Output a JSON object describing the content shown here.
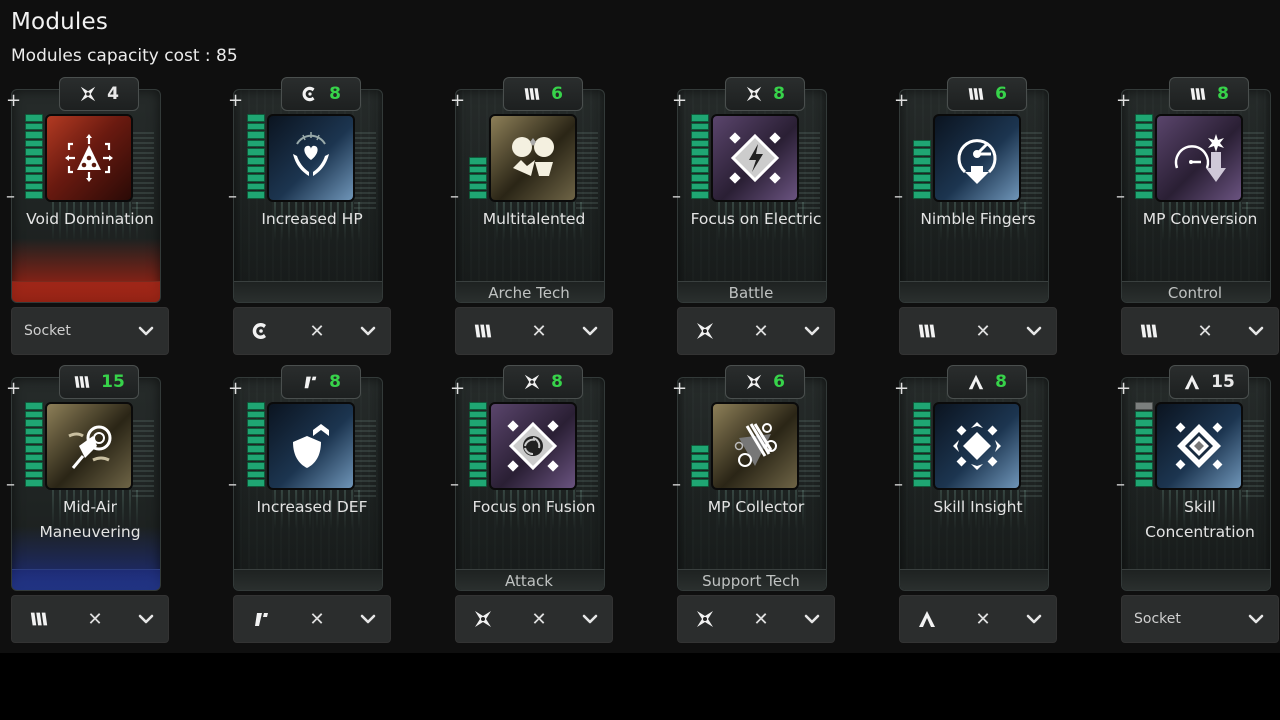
{
  "header": {
    "title": "Modules",
    "capacity_label": "Modules capacity cost : 85"
  },
  "colors": {
    "bar_on": "#1fa673",
    "bar_off": "#7b7f7e",
    "cost_green": "#37d34a"
  },
  "modules": [
    {
      "name": "Void Domination",
      "slot_icon": "shuriken-icon",
      "cost": "4",
      "cost_color": "white",
      "level": 10,
      "max_level": 10,
      "icon": "void-domination-icon",
      "bg": "red",
      "tint": "red",
      "category": "",
      "socket": "Socket",
      "equipped": false
    },
    {
      "name": "Increased HP",
      "slot_icon": "crescent-icon",
      "cost": "8",
      "cost_color": "green",
      "level": 10,
      "max_level": 10,
      "icon": "heart-hands-icon",
      "bg": "blue",
      "tint": "",
      "category": "",
      "socket": "",
      "equipped": true
    },
    {
      "name": "Multitalented",
      "slot_icon": "triple-bars-icon",
      "cost": "6",
      "cost_color": "green",
      "level": 5,
      "max_level": 10,
      "icon": "multitalented-icon",
      "bg": "gold",
      "tint": "",
      "category": "Arche Tech",
      "socket": "",
      "equipped": true
    },
    {
      "name": "Focus on Electric",
      "slot_icon": "shuriken-icon",
      "cost": "8",
      "cost_color": "green",
      "level": 10,
      "max_level": 10,
      "icon": "electric-diamond-icon",
      "bg": "purple",
      "tint": "",
      "category": "Battle",
      "socket": "",
      "equipped": true
    },
    {
      "name": "Nimble Fingers",
      "slot_icon": "triple-bars-icon",
      "cost": "6",
      "cost_color": "green",
      "level": 7,
      "max_level": 10,
      "icon": "stopwatch-down-icon",
      "bg": "blue",
      "tint": "",
      "category": "",
      "socket": "",
      "equipped": true
    },
    {
      "name": "MP Conversion",
      "slot_icon": "triple-bars-icon",
      "cost": "8",
      "cost_color": "green",
      "level": 10,
      "max_level": 10,
      "icon": "gauge-down-icon",
      "bg": "purple",
      "tint": "",
      "category": "Control",
      "socket": "",
      "equipped": true
    },
    {
      "name": "Mid-Air Maneuvering",
      "slot_icon": "triple-bars-icon",
      "cost": "15",
      "cost_color": "green",
      "level": 10,
      "max_level": 10,
      "icon": "grapple-icon",
      "bg": "gold",
      "tint": "blue",
      "category": "",
      "socket": "",
      "equipped": true
    },
    {
      "name": "Increased DEF",
      "slot_icon": "slash-mark-icon",
      "cost": "8",
      "cost_color": "green",
      "level": 10,
      "max_level": 10,
      "icon": "shield-up-icon",
      "bg": "blue",
      "tint": "",
      "category": "",
      "socket": "",
      "equipped": true
    },
    {
      "name": "Focus on Fusion",
      "slot_icon": "shuriken-icon",
      "cost": "8",
      "cost_color": "green",
      "level": 10,
      "max_level": 10,
      "icon": "fusion-diamond-icon",
      "bg": "purple",
      "tint": "",
      "category": "Attack",
      "socket": "",
      "equipped": true
    },
    {
      "name": "MP Collector",
      "slot_icon": "shuriken-icon",
      "cost": "6",
      "cost_color": "green",
      "level": 5,
      "max_level": 10,
      "icon": "claw-targets-icon",
      "bg": "gold",
      "tint": "",
      "category": "Support Tech",
      "socket": "",
      "equipped": true
    },
    {
      "name": "Skill Insight",
      "slot_icon": "chevron-up-icon",
      "cost": "8",
      "cost_color": "green",
      "level": 10,
      "max_level": 10,
      "icon": "insight-diamond-icon",
      "bg": "blue",
      "tint": "",
      "category": "",
      "socket": "",
      "equipped": true
    },
    {
      "name": "Skill Concentration",
      "slot_icon": "chevron-up-icon",
      "cost": "15",
      "cost_color": "white",
      "level": 9,
      "max_level": 10,
      "icon": "concentric-diamond-icon",
      "bg": "blue",
      "tint": "",
      "category": "",
      "socket": "Socket",
      "equipped": false
    }
  ],
  "controls": {
    "plus": "+",
    "minus": "–",
    "remove": "✕"
  }
}
